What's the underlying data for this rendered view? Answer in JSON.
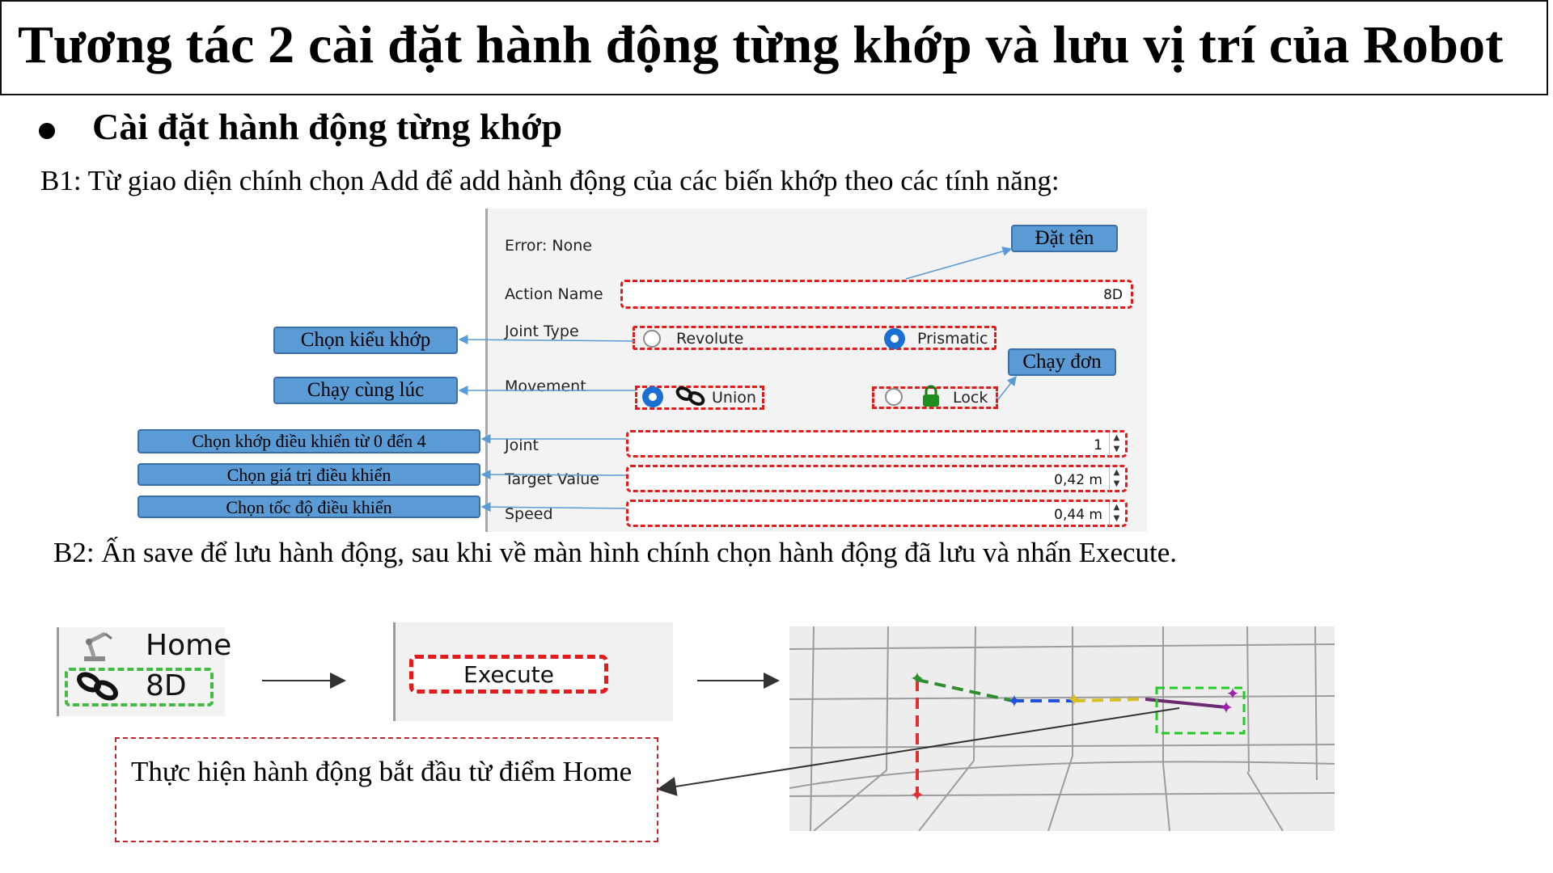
{
  "title": "Tương tác 2 cài đặt hành động từng khớp và lưu vị trí của Robot",
  "bullet": "Cài đặt hành động từng khớp",
  "step1": "B1: Từ giao diện chính chọn Add để add hành động của các biến khớp theo các tính năng:",
  "step2": "B2: Ấn save để lưu hành động, sau khi về màn hình chính chọn hành động đã lưu và nhấn Execute.",
  "form": {
    "error": "Error: None",
    "action_name_label": "Action Name",
    "action_name_value": "8D",
    "joint_type_label": "Joint Type",
    "revolute": "Revolute",
    "prismatic": "Prismatic",
    "movement_label": "Movement",
    "union": "Union",
    "lock": "Lock",
    "joint_label": "Joint",
    "joint_value": "1",
    "target_label": "Target Value",
    "target_value": "0,42 m",
    "speed_label": "Speed",
    "speed_value": "0,44 m",
    "spin_up": "▲",
    "spin_down": "▼"
  },
  "callouts": {
    "dat_ten": "Đặt tên",
    "chon_kieu_khop": "Chọn kiểu khớp",
    "chay_don": "Chạy đơn",
    "chay_cung_luc": "Chạy cùng lúc",
    "chon_khop": "Chọn khớp điều khiển từ 0 đến 4",
    "chon_gia_tri": "Chọn giá trị điều khiển",
    "chon_toc_do": "Chọn tốc độ điều khiển"
  },
  "bottom": {
    "home": "Home",
    "action": "8D",
    "execute": "Execute",
    "note": "Thực hiện hành động bắt đầu từ điểm Home"
  },
  "colors": {
    "dashed_red": "#e31b1b",
    "callout_blue": "#5b9bd5",
    "radio_blue": "#1a6fd4",
    "note_border": "#c0272d",
    "highlight_green": "#22cc22"
  },
  "icons": [
    "robot-arm-icon",
    "chain-link-icon",
    "lock-icon",
    "star-marker-icon"
  ]
}
